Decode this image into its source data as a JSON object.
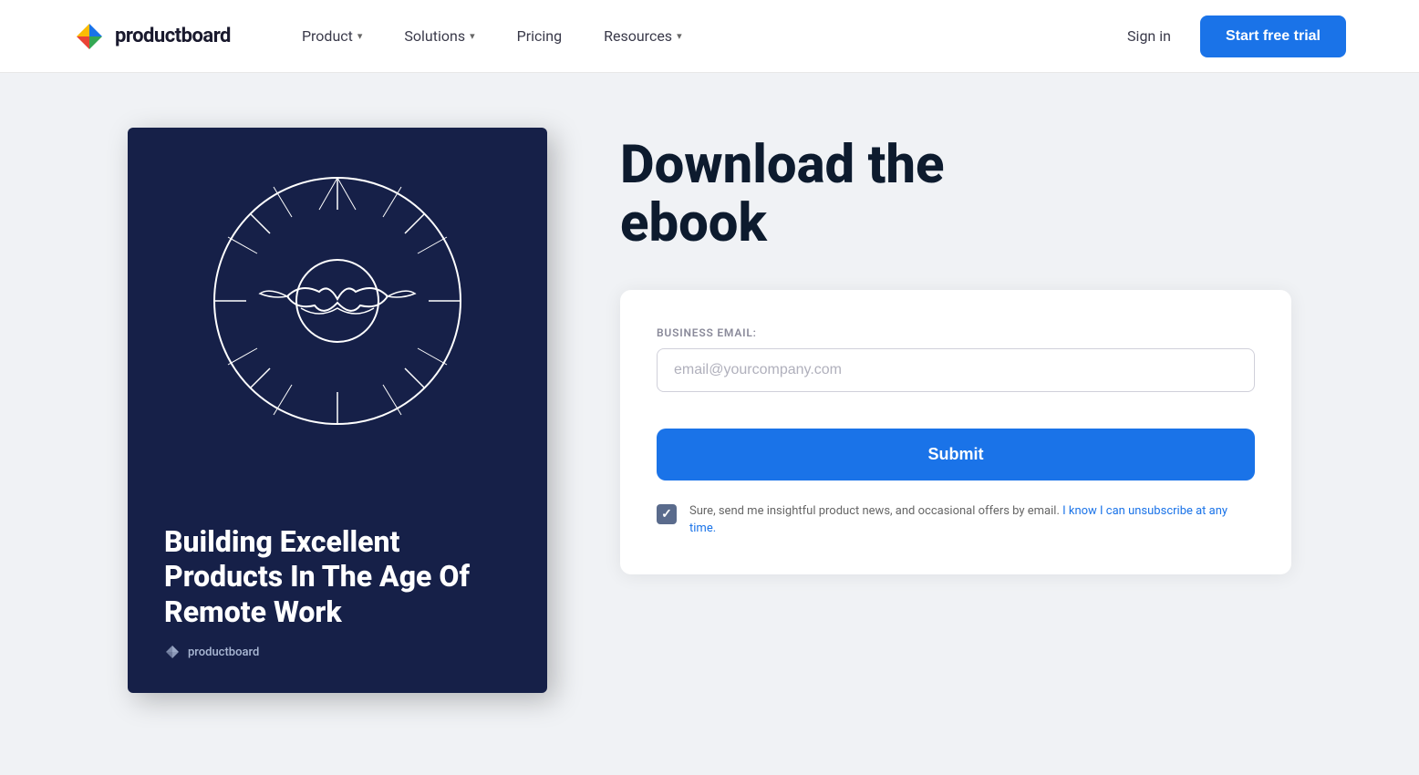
{
  "navbar": {
    "logo_text": "productboard",
    "nav_items": [
      {
        "label": "Product",
        "has_chevron": true
      },
      {
        "label": "Solutions",
        "has_chevron": true
      },
      {
        "label": "Pricing",
        "has_chevron": false
      },
      {
        "label": "Resources",
        "has_chevron": true
      }
    ],
    "sign_in_label": "Sign in",
    "start_trial_label": "Start free trial"
  },
  "hero": {
    "heading_line1": "Download the",
    "heading_line2": "ebook"
  },
  "form": {
    "field_label": "BUSINESS EMAIL:",
    "email_placeholder": "email@yourcompany.com",
    "submit_label": "Submit",
    "consent_text": "Sure, send me insightful product news, and occasional offers by email. I know I can unsubscribe at any time."
  },
  "book": {
    "title": "Building Excellent Products In The Age Of Remote Work",
    "brand_text": "productboard"
  }
}
